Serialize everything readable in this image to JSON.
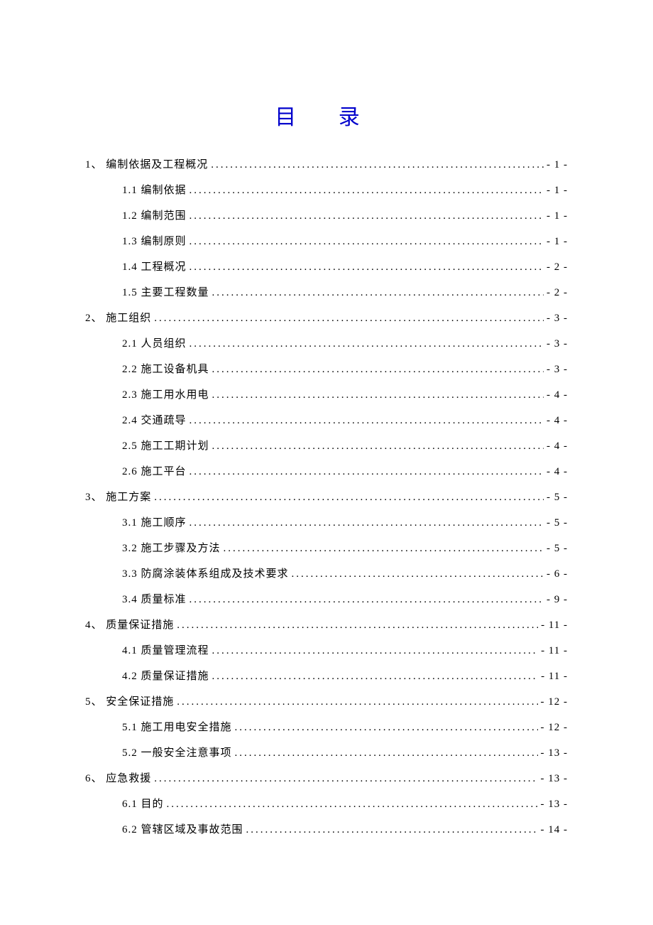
{
  "title": "目 录",
  "entries": [
    {
      "level": 1,
      "label": "1、 编制依据及工程概况",
      "page": "- 1 -"
    },
    {
      "level": 2,
      "label": "1.1 编制依据",
      "page": "- 1 -"
    },
    {
      "level": 2,
      "label": "1.2 编制范围",
      "page": "- 1 -"
    },
    {
      "level": 2,
      "label": "1.3 编制原则",
      "page": "- 1 -"
    },
    {
      "level": 2,
      "label": "1.4 工程概况",
      "page": "- 2 -"
    },
    {
      "level": 2,
      "label": "1.5 主要工程数量",
      "page": "- 2 -"
    },
    {
      "level": 1,
      "label": "2、 施工组织",
      "page": "- 3 -"
    },
    {
      "level": 2,
      "label": "2.1 人员组织",
      "page": "- 3 -"
    },
    {
      "level": 2,
      "label": "2.2 施工设备机具",
      "page": "- 3 -"
    },
    {
      "level": 2,
      "label": "2.3 施工用水用电",
      "page": "- 4 -"
    },
    {
      "level": 2,
      "label": "2.4 交通疏导",
      "page": "- 4 -"
    },
    {
      "level": 2,
      "label": "2.5 施工工期计划",
      "page": "- 4 -"
    },
    {
      "level": 2,
      "label": "2.6 施工平台",
      "page": "- 4 -"
    },
    {
      "level": 1,
      "label": "3、  施工方案",
      "page": "- 5 -"
    },
    {
      "level": 2,
      "label": "3.1 施工顺序",
      "page": "- 5 -"
    },
    {
      "level": 2,
      "label": "3.2 施工步骤及方法",
      "page": "- 5 -"
    },
    {
      "level": 2,
      "label": "3.3 防腐涂装体系组成及技术要求",
      "page": "- 6 -"
    },
    {
      "level": 2,
      "label": "3.4 质量标准",
      "page": "- 9 -"
    },
    {
      "level": 1,
      "label": "4、 质量保证措施",
      "page": "- 11 -"
    },
    {
      "level": 2,
      "label": "4.1 质量管理流程",
      "page": "- 11 -"
    },
    {
      "level": 2,
      "label": "4.2 质量保证措施",
      "page": "- 11 -"
    },
    {
      "level": 1,
      "label": "5、 安全保证措施",
      "page": "- 12 -"
    },
    {
      "level": 2,
      "label": "5.1 施工用电安全措施",
      "page": "- 12 -"
    },
    {
      "level": 2,
      "label": "5.2 一般安全注意事项",
      "page": "- 13 -"
    },
    {
      "level": 1,
      "label": "6、  应急救援",
      "page": "- 13 -"
    },
    {
      "level": 2,
      "label": "6.1 目的",
      "page": "- 13 -"
    },
    {
      "level": 2,
      "label": "6.2 管辖区域及事故范围",
      "page": "- 14 -"
    }
  ]
}
